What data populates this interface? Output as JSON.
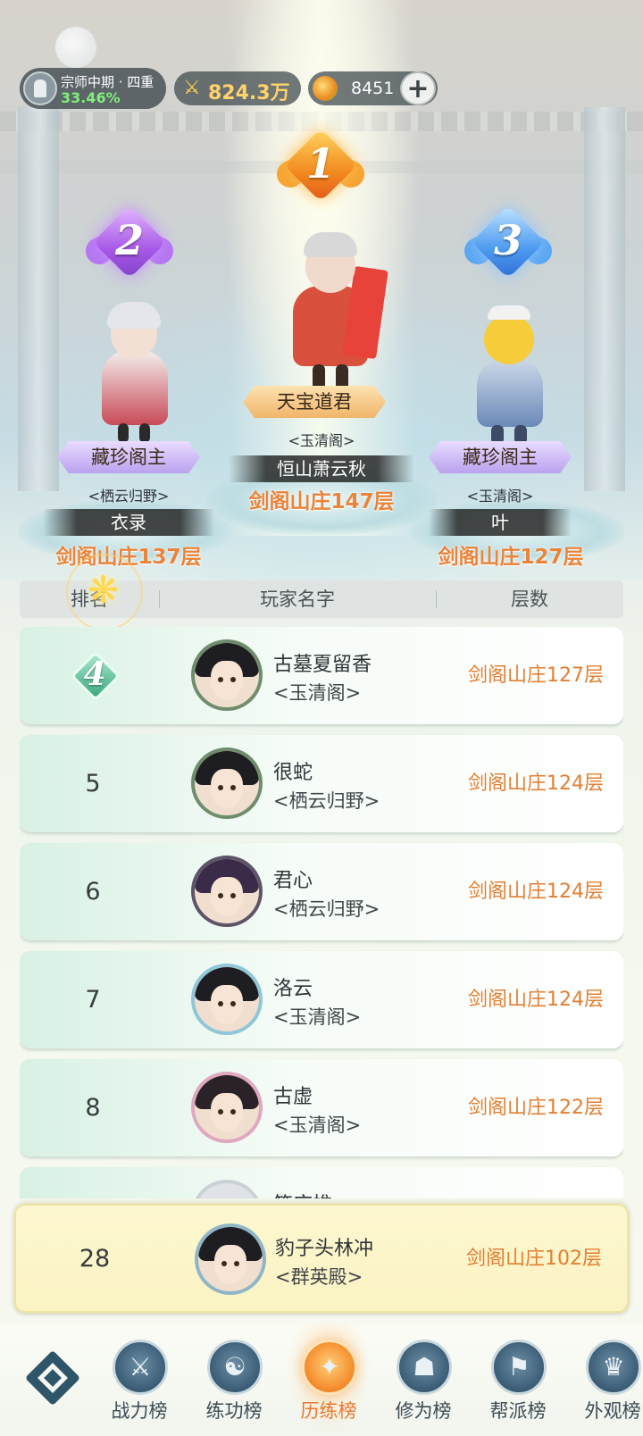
{
  "header": {
    "level_title": "宗师中期 · 四重",
    "level_percent": "33.46%",
    "power_value": "824.3万",
    "coin_value": "8451",
    "plus_label": "+"
  },
  "podium": {
    "first": {
      "rank": "1",
      "title": "天宝道君",
      "guild": "<玉清阁>",
      "player": "恒山萧云秋",
      "floor": "剑阁山庄147层"
    },
    "second": {
      "rank": "2",
      "title": "藏珍阁主",
      "guild": "<栖云归野>",
      "player": "衣录",
      "floor": "剑阁山庄137层"
    },
    "third": {
      "rank": "3",
      "title": "藏珍阁主",
      "guild": "<玉清阁>",
      "player": "叶",
      "floor": "剑阁山庄127层"
    }
  },
  "table": {
    "headers": [
      "排名",
      "玩家名字",
      "层数"
    ],
    "rows": [
      {
        "rank": "4",
        "name": "古墓夏留香",
        "guild": "<玉清阁>",
        "floor": "剑阁山庄127层"
      },
      {
        "rank": "5",
        "name": "很蛇",
        "guild": "<栖云归野>",
        "floor": "剑阁山庄124层"
      },
      {
        "rank": "6",
        "name": "君心",
        "guild": "<栖云归野>",
        "floor": "剑阁山庄124层"
      },
      {
        "rank": "7",
        "name": "洛云",
        "guild": "<玉清阁>",
        "floor": "剑阁山庄124层"
      },
      {
        "rank": "8",
        "name": "古虚",
        "guild": "<玉清阁>",
        "floor": "剑阁山庄122层"
      },
      {
        "rank": "",
        "name": "笑床椎",
        "guild": "",
        "floor": ""
      }
    ]
  },
  "my_rank": {
    "rank": "28",
    "name": "豹子头林冲",
    "guild": "<群英殿>",
    "floor": "剑阁山庄102层"
  },
  "nav": {
    "tabs": [
      {
        "label": "战力榜",
        "icon": "crossed-swords-icon",
        "glyph": "⚔"
      },
      {
        "label": "练功榜",
        "icon": "yin-yang-icon",
        "glyph": "☯"
      },
      {
        "label": "历练榜",
        "icon": "compass-star-icon",
        "glyph": "✦"
      },
      {
        "label": "修为榜",
        "icon": "hat-icon",
        "glyph": "☗"
      },
      {
        "label": "帮派榜",
        "icon": "banner-icon",
        "glyph": "⚑"
      },
      {
        "label": "外观榜",
        "icon": "mask-icon",
        "glyph": "♛"
      }
    ],
    "active_index": 2
  },
  "colors": {
    "floor_text": "#e27f33",
    "rank1": "#f28a1e",
    "rank2": "#a758e6",
    "rank3": "#4c9af0",
    "active_tab": "#e9782f"
  }
}
